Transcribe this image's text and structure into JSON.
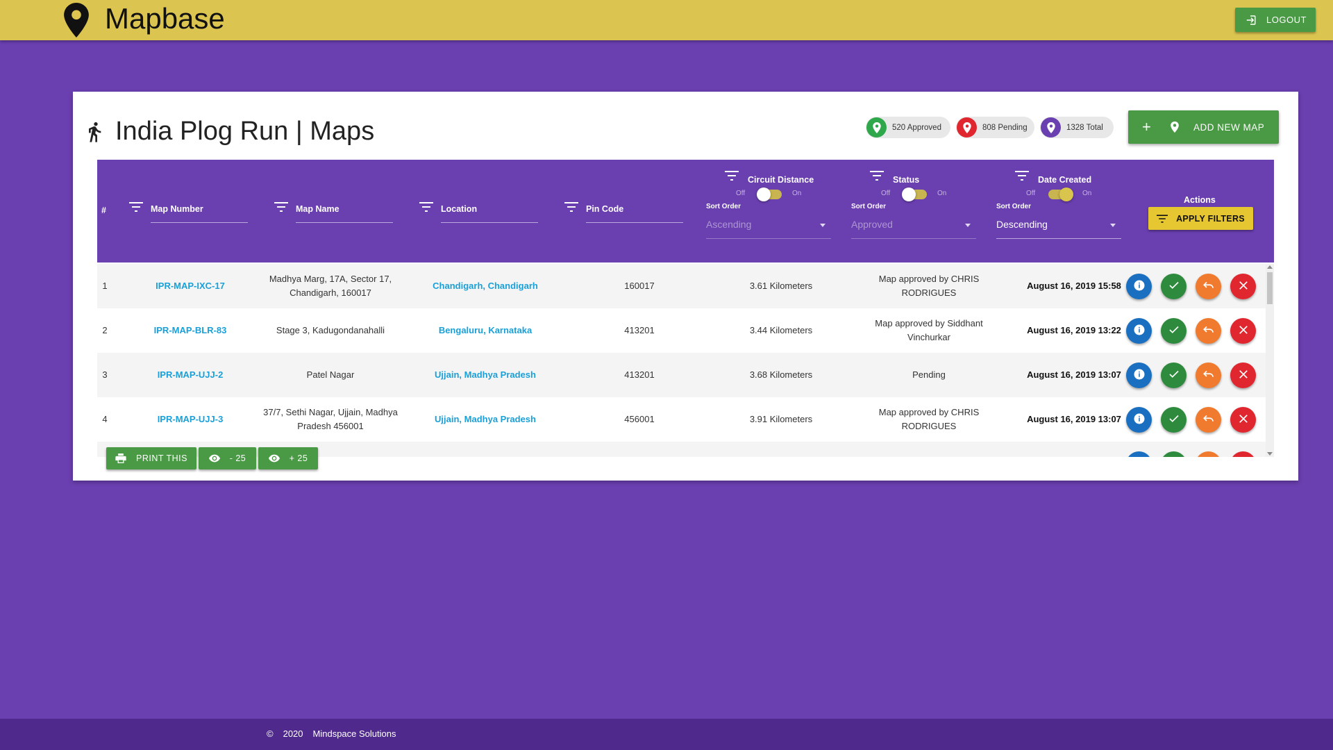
{
  "app": {
    "name": "Mapbase",
    "logout_label": "LOGOUT"
  },
  "page": {
    "title": "India Plog Run | Maps",
    "stats": {
      "approved": "520 Approved",
      "pending": "808 Pending",
      "total": "1328 Total"
    },
    "add_map_label": "ADD NEW MAP"
  },
  "table": {
    "headers": {
      "index": "#",
      "map_number": "Map Number",
      "map_name": "Map Name",
      "location": "Location",
      "pin_code": "Pin Code",
      "circuit_distance": "Circuit Distance",
      "status": "Status",
      "date_created": "Date Created",
      "actions": "Actions"
    },
    "toggle_off": "Off",
    "toggle_on": "On",
    "sort_order_label": "Sort Order",
    "sorts": {
      "distance": "Ascending",
      "status": "Approved",
      "date": "Descending"
    },
    "toggles": {
      "distance": false,
      "status": false,
      "date": true
    },
    "apply_filters_label": "APPLY FILTERS",
    "rows": [
      {
        "idx": "1",
        "number": "IPR-MAP-IXC-17",
        "name": "Madhya Marg, 17A, Sector 17, Chandigarh, 160017",
        "location": "Chandigarh, Chandigarh",
        "pin": "160017",
        "distance": "3.61 Kilometers",
        "status": "Map approved by CHRIS RODRIGUES",
        "date": "August 16, 2019 15:58"
      },
      {
        "idx": "2",
        "number": "IPR-MAP-BLR-83",
        "name": "Stage 3, Kadugondanahalli",
        "location": "Bengaluru, Karnataka",
        "pin": "413201",
        "distance": "3.44 Kilometers",
        "status": "Map approved by Siddhant Vinchurkar",
        "date": "August 16, 2019 13:22"
      },
      {
        "idx": "3",
        "number": "IPR-MAP-UJJ-2",
        "name": "Patel Nagar",
        "location": "Ujjain, Madhya Pradesh",
        "pin": "413201",
        "distance": "3.68 Kilometers",
        "status": "Pending",
        "date": "August 16, 2019 13:07"
      },
      {
        "idx": "4",
        "number": "IPR-MAP-UJJ-3",
        "name": "37/7, Sethi Nagar, Ujjain, Madhya Pradesh 456001",
        "location": "Ujjain, Madhya Pradesh",
        "pin": "456001",
        "distance": "3.91 Kilometers",
        "status": "Map approved by CHRIS RODRIGUES",
        "date": "August 16, 2019 13:07"
      }
    ]
  },
  "bottom_buttons": {
    "print": "PRINT THIS",
    "minus": "- 25",
    "plus": "+ 25"
  },
  "footer": {
    "copyright": "©",
    "year": "2020",
    "company": "Mindspace Solutions"
  },
  "colors": {
    "primary": "#6a3fb0",
    "topbar": "#dcc450",
    "green": "#4a9a45",
    "link": "#1aa0d8"
  }
}
